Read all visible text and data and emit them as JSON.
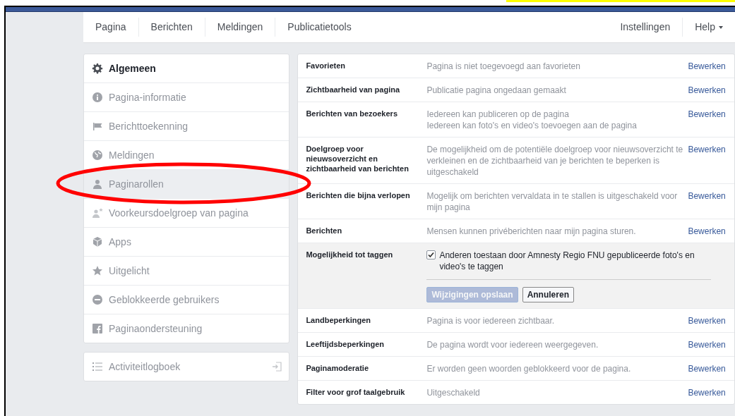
{
  "nav": {
    "left": [
      {
        "label": "Pagina"
      },
      {
        "label": "Berichten"
      },
      {
        "label": "Meldingen"
      },
      {
        "label": "Publicatietools"
      }
    ],
    "right": [
      {
        "label": "Instellingen",
        "dropdown": false
      },
      {
        "label": "Help",
        "dropdown": true
      }
    ]
  },
  "sidebar": {
    "items": [
      {
        "label": "Algemeen",
        "selected": true,
        "hovered": false
      },
      {
        "label": "Pagina-informatie",
        "selected": false,
        "hovered": false
      },
      {
        "label": "Berichttoekenning",
        "selected": false,
        "hovered": false
      },
      {
        "label": "Meldingen",
        "selected": false,
        "hovered": false
      },
      {
        "label": "Paginarollen",
        "selected": false,
        "hovered": true
      },
      {
        "label": "Voorkeursdoelgroep van pagina",
        "selected": false,
        "hovered": false
      },
      {
        "label": "Apps",
        "selected": false,
        "hovered": false
      },
      {
        "label": "Uitgelicht",
        "selected": false,
        "hovered": false
      },
      {
        "label": "Geblokkeerde gebruikers",
        "selected": false,
        "hovered": false
      },
      {
        "label": "Paginaondersteuning",
        "selected": false,
        "hovered": false
      }
    ],
    "activity_log": {
      "label": "Activiteitlogboek"
    }
  },
  "settings": [
    {
      "kind": "setting",
      "label": "Favorieten",
      "value": [
        "Pagina is niet toegevoegd aan favorieten"
      ],
      "action": "Bewerken"
    },
    {
      "kind": "setting",
      "label": "Zichtbaarheid van pagina",
      "value": [
        "Publicatie pagina ongedaan gemaakt"
      ],
      "action": "Bewerken"
    },
    {
      "kind": "setting",
      "label": "Berichten van bezoekers",
      "value": [
        "Iedereen kan publiceren op de pagina",
        "Iedereen kan foto's en video's toevoegen aan de pagina"
      ],
      "action": "Bewerken"
    },
    {
      "kind": "setting",
      "label": "Doelgroep voor nieuwsoverzicht en zichtbaarheid van berichten",
      "value": [
        "De mogelijkheid om de potentiële doelgroep voor nieuwsoverzicht te verkleinen en de zichtbaarheid van je berichten te beperken is uitgeschakeld"
      ],
      "action": "Bewerken"
    },
    {
      "kind": "setting",
      "label": "Berichten die bijna verlopen",
      "value": [
        "Mogelijk om berichten vervaldata in te stallen is uitgeschakeld voor mijn pagina"
      ],
      "action": "Bewerken"
    },
    {
      "kind": "setting",
      "label": "Berichten",
      "value": [
        "Mensen kunnen privéberichten naar mijn pagina sturen."
      ],
      "action": "Bewerken"
    },
    {
      "kind": "edit",
      "label": "Mogelijkheid tot taggen",
      "option": {
        "label": "Anderen toestaan door Amnesty Regio FNU gepubliceerde foto's en video's te taggen",
        "checked": true
      },
      "save": {
        "label": "Wijzigingen opslaan",
        "disabled": true
      },
      "cancel": {
        "label": "Annuleren"
      }
    },
    {
      "kind": "setting",
      "label": "Landbeperkingen",
      "value": [
        "Pagina is voor iedereen zichtbaar."
      ],
      "action": "Bewerken"
    },
    {
      "kind": "setting",
      "label": "Leeftijdsbeperkingen",
      "value": [
        "De pagina wordt voor iedereen weergegeven."
      ],
      "action": "Bewerken"
    },
    {
      "kind": "setting",
      "label": "Paginamoderatie",
      "value": [
        "Er worden geen woorden geblokkeerd voor de pagina."
      ],
      "action": "Bewerken"
    },
    {
      "kind": "setting",
      "label": "Filter voor grof taalgebruik",
      "value": [
        "Uitgeschakeld"
      ],
      "action": "Bewerken"
    }
  ]
}
